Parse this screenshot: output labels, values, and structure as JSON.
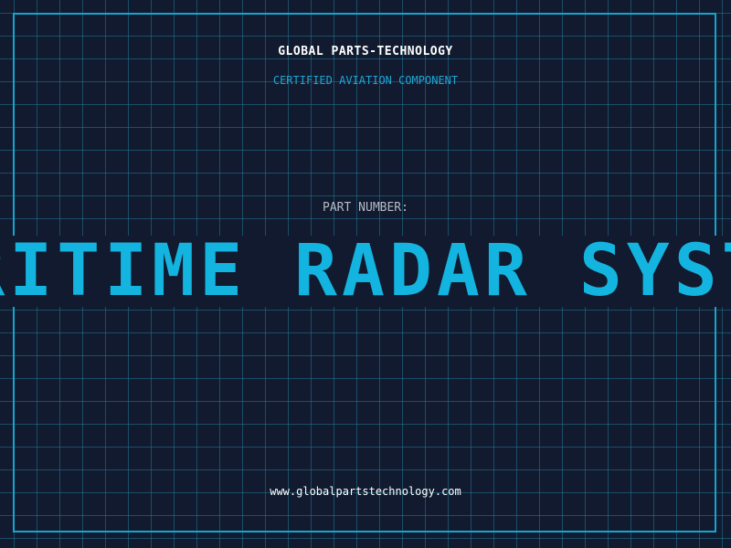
{
  "header": {
    "company": "GLOBAL PARTS-TECHNOLOGY",
    "subtitle": "CERTIFIED AVIATION COMPONENT"
  },
  "part": {
    "label": "PART NUMBER:",
    "name": "MARITIME RADAR SYSTEM"
  },
  "footer": {
    "url": "www.globalpartstechnology.com"
  },
  "colors": {
    "background": "#111a2e",
    "grid": "#217896",
    "accent": "#13b4df",
    "text": "#ffffff",
    "muted": "#b4bcc8"
  }
}
